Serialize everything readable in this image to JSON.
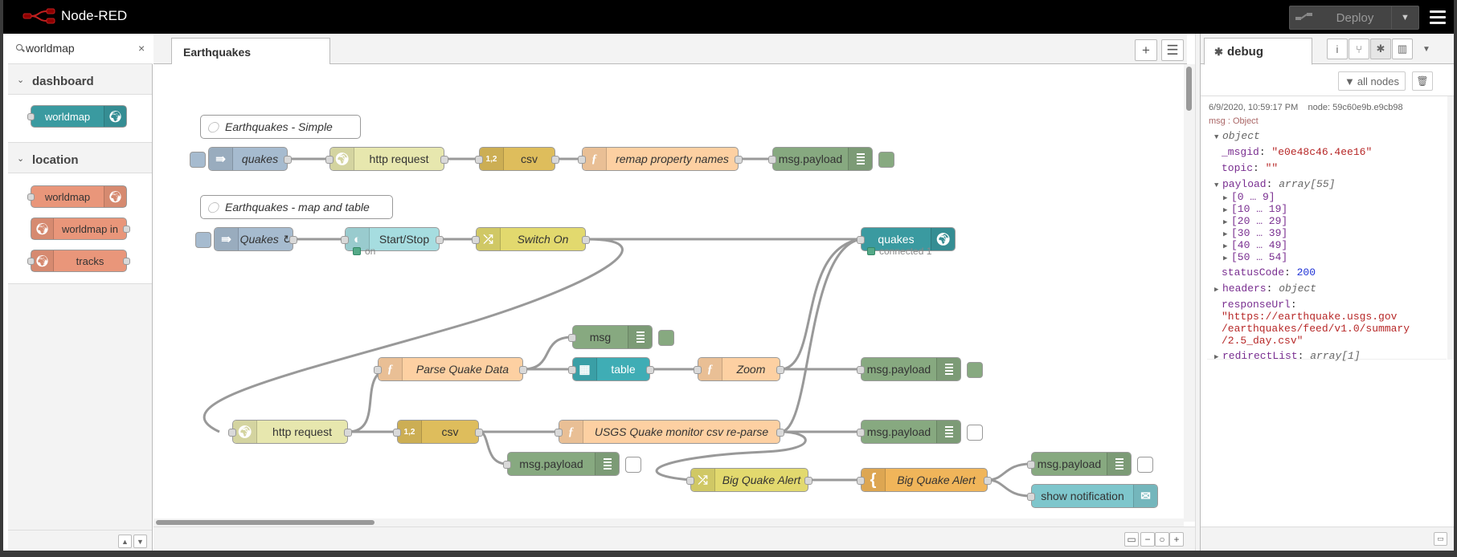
{
  "header": {
    "app_title": "Node-RED",
    "deploy_label": "Deploy"
  },
  "palette": {
    "search_value": "worldmap",
    "categories": [
      {
        "label": "dashboard",
        "nodes": [
          "worldmap"
        ]
      },
      {
        "label": "location",
        "nodes": [
          "worldmap",
          "worldmap in",
          "tracks"
        ]
      }
    ]
  },
  "workspace": {
    "tab_label": "Earthquakes",
    "comments": [
      "Earthquakes - Simple",
      "Earthquakes - map and table"
    ],
    "nodes": {
      "inject_quakes": "quakes",
      "http_request_1": "http request",
      "csv_1": "csv",
      "remap": "remap property names",
      "debug_payload_1": "msg.payload",
      "inject_quakes_2": "Quakes ↻",
      "start_stop": "Start/Stop",
      "switch_on": "Switch On",
      "worldmap_quakes": "quakes",
      "msg_debug": "msg",
      "parse_quake": "Parse Quake Data",
      "table": "table",
      "zoom": "Zoom",
      "debug_payload_2": "msg.payload",
      "http_request_2": "http request",
      "csv_2": "csv",
      "usgs_reparse": "USGS Quake monitor csv re-parse",
      "debug_payload_3": "msg.payload",
      "debug_payload_4": "msg.payload",
      "big_quake_switch": "Big Quake Alert",
      "big_quake_template": "Big Quake Alert",
      "debug_payload_5": "msg.payload",
      "show_notification": "show notification"
    },
    "status": {
      "start_stop": "on",
      "worldmap_quakes": "connected 1"
    }
  },
  "sidebar": {
    "tab_label": "debug",
    "filter_label": "all nodes",
    "message": {
      "timestamp": "6/9/2020, 10:59:17 PM",
      "node": "node: 59c60e9b.e9cb98",
      "topic": "msg : Object",
      "root": "object",
      "msgid_key": "_msgid",
      "msgid_val": "\"e0e48c46.4ee16\"",
      "topic_key": "topic",
      "topic_val": "\"\"",
      "payload_key": "payload",
      "payload_type": "array[55]",
      "ranges": [
        "[0 … 9]",
        "[10 … 19]",
        "[20 … 29]",
        "[30 … 39]",
        "[40 … 49]",
        "[50 … 54]"
      ],
      "status_key": "statusCode",
      "status_val": "200",
      "headers_key": "headers",
      "headers_type": "object",
      "responseurl_key": "responseUrl",
      "responseurl_val": [
        "\"https://earthquake.usgs.gov",
        "/earthquakes/feed/v1.0/summary",
        "/2.5_day.csv\""
      ],
      "redirect_key": "redirectList",
      "redirect_type": "array[1]"
    }
  },
  "colors": {
    "inject": "#a6bbcf",
    "http": "#e7e7ae",
    "csv": "#debd5c",
    "function": "#fdd0a2",
    "debug": "#87a980",
    "worldmap": "#3a9aa0",
    "location": "#e9967a",
    "switch": "#e2d96e",
    "template": "#f0b55a",
    "table": "#3fadb5",
    "notify": "#7ec6cc",
    "ui_switch": "#a6dde0"
  }
}
